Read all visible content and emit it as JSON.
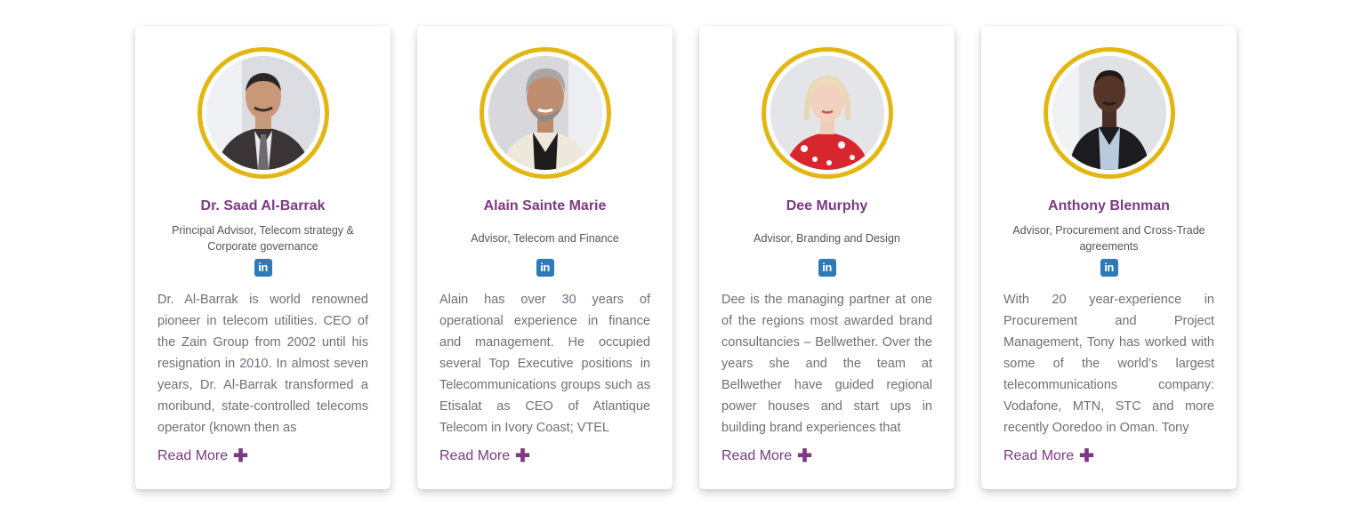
{
  "colors": {
    "accent_ring": "#e2b714",
    "name": "#7b3a83",
    "linkedin": "#2f7ab8"
  },
  "advisors": [
    {
      "name": "Dr. Saad Al-Barrak",
      "role": "Principal Advisor, Telecom strategy & Corporate governance",
      "linkedin_icon": "in",
      "bio": "Dr. Al-Barrak is world renowned pioneer in telecom utilities. CEO of the Zain Group from 2002 until his resignation in 2010. In almost seven years, Dr. Al-Barrak transformed a moribund, state-controlled telecoms operator (known then as",
      "read_more": "Read More",
      "plus": "✚"
    },
    {
      "name": "Alain Sainte Marie",
      "role": "Advisor, Telecom and Finance",
      "linkedin_icon": "in",
      "bio": "Alain has over 30 years of operational experience in finance and management. He occupied several Top Executive positions in Telecommunications groups such as Etisalat as CEO of Atlantique Telecom in Ivory Coast; VTEL",
      "read_more": "Read More",
      "plus": "✚"
    },
    {
      "name": "Dee Murphy",
      "role": "Advisor, Branding and Design",
      "linkedin_icon": "in",
      "bio": "Dee is the managing partner at one of the regions most awarded brand consultancies – Bellwether. Over the years she and the team at Bellwether have guided regional power houses and start ups in building brand experiences that",
      "read_more": "Read More",
      "plus": "✚"
    },
    {
      "name": "Anthony Blenman",
      "role": "Advisor, Procurement and Cross-Trade agreements",
      "linkedin_icon": "in",
      "bio": "With 20 year-experience in Procurement and Project Management, Tony has worked with some of the world’s largest telecommunications company: Vodafone, MTN, STC and more recently Ooredoo in Oman. Tony",
      "read_more": "Read More",
      "plus": "✚"
    }
  ]
}
